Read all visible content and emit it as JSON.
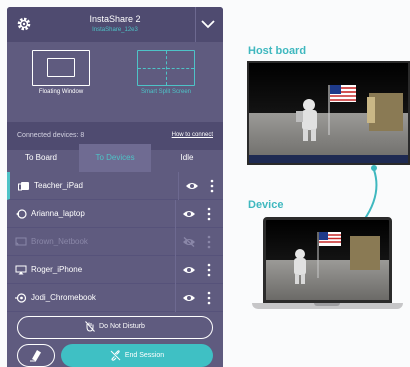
{
  "header": {
    "title": "InstaShare 2",
    "subtitle": "InstaShare_12e3"
  },
  "layout_options": {
    "floating": "Floating Window",
    "split": "Smart Split Screen",
    "selected": "Smart Split Screen"
  },
  "connection": {
    "count_label": "Connected devices: 8",
    "help_link": "How to connect"
  },
  "tabs": [
    {
      "label": "To Board",
      "active": false
    },
    {
      "label": "To Devices",
      "active": true
    },
    {
      "label": "Idle",
      "active": false
    }
  ],
  "devices": [
    {
      "name": "Teacher_iPad",
      "icon": "tablet-icon",
      "visible": true,
      "selected": true
    },
    {
      "name": "Arianna_laptop",
      "icon": "cast-icon",
      "visible": true,
      "selected": false
    },
    {
      "name": "Brown_Netbook",
      "icon": "screen-mirror-icon",
      "visible": false,
      "selected": false
    },
    {
      "name": "Roger_iPhone",
      "icon": "airplay-icon",
      "visible": true,
      "selected": false
    },
    {
      "name": "Jodi_Chromebook",
      "icon": "chromecast-icon",
      "visible": true,
      "selected": false
    }
  ],
  "actions": {
    "do_not_disturb": "Do Not Disturb",
    "end_session": "End Session"
  },
  "illustration": {
    "host_label": "Host board",
    "device_label": "Device"
  },
  "colors": {
    "panel": "#5f5b7f",
    "panel_dark": "#4f4b70",
    "accent": "#4ec3c7",
    "end_button": "#3fc0c4",
    "label": "#3fb8bf"
  }
}
